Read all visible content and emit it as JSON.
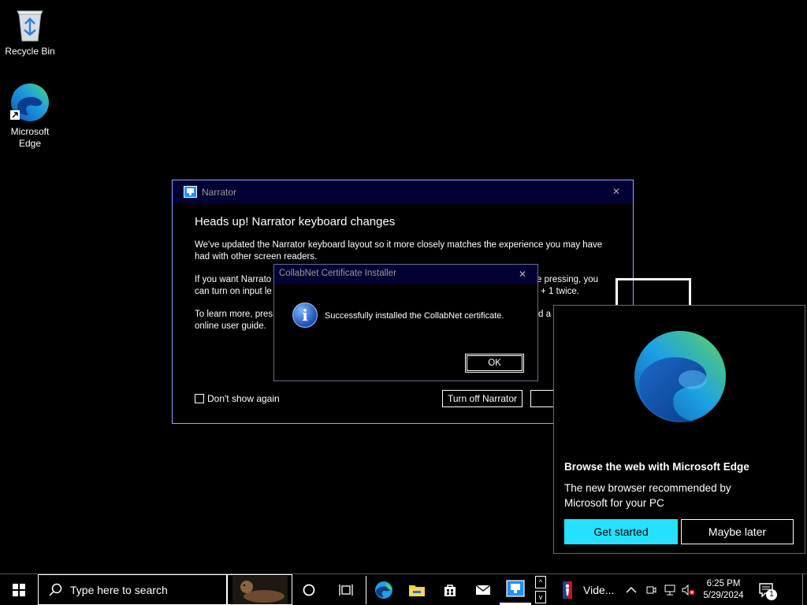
{
  "desktop": {
    "icons": [
      {
        "label": "Recycle Bin"
      },
      {
        "label": "Microsoft\nEdge"
      }
    ]
  },
  "narrator": {
    "title": "Narrator",
    "close": "✕",
    "heading": "Heads up! Narrator keyboard changes",
    "para1": "We've updated the Narrator keyboard layout so it more closely matches the experience you may have had with other screen readers.",
    "para2_left": "If you want Narrato",
    "para2_right": "e pressing, you",
    "para2b_left": "can turn on input le",
    "para2b_right": "+ 1 twice.",
    "para3_left": "To learn more, pres",
    "para3_right": "nd a",
    "para3b": "online user guide.",
    "checkbox_label": "Don't show again",
    "checkbox_checked": false,
    "turn_off_label": "Turn off Narrator"
  },
  "collab": {
    "title": "CollabNet Certificate Installer",
    "close": "✕",
    "message": "Successfully installed the CollabNet certificate.",
    "info_icon_letter": "i",
    "ok_label": "OK"
  },
  "promo": {
    "title": "Browse the web with Microsoft Edge",
    "body": "The new browser recommended by Microsoft for your PC",
    "get_started": "Get started",
    "maybe_later": "Maybe later",
    "accent": "#24e2ff"
  },
  "taskbar": {
    "search_placeholder": "Type here to search",
    "app_label": "Vide...",
    "time": "6:25 PM",
    "date": "5/29/2024",
    "notification_count": "1"
  }
}
